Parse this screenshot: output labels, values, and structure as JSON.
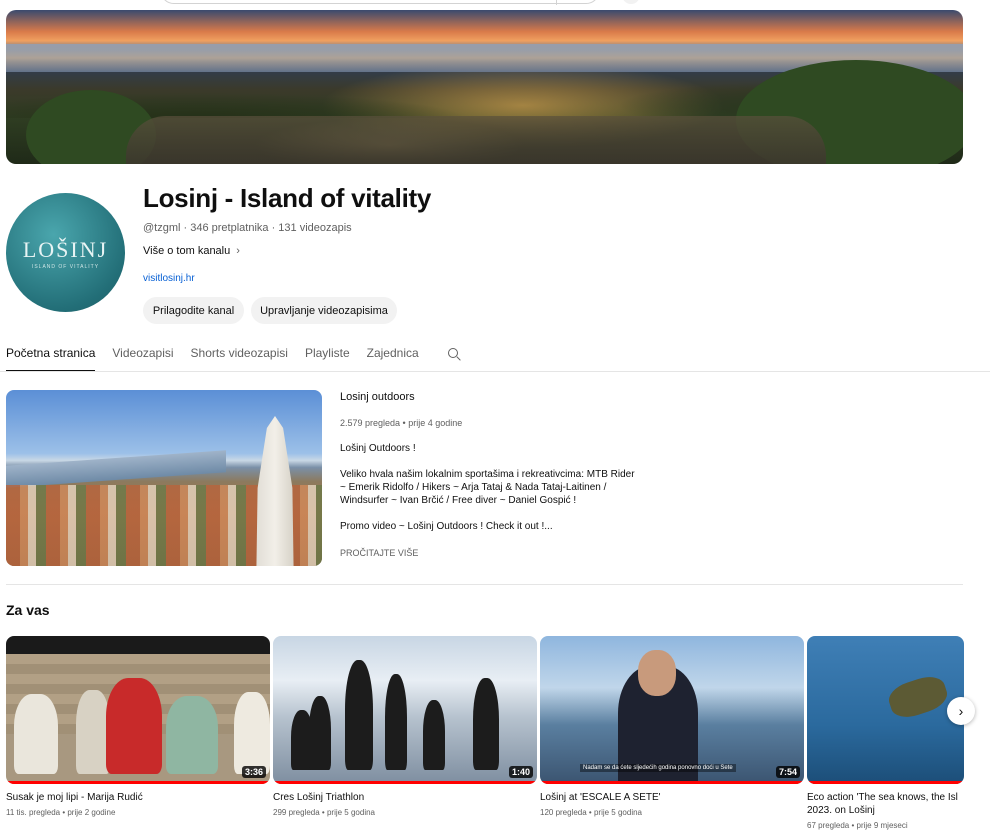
{
  "channel": {
    "name": "Losinj - Island of vitality",
    "handle": "@tzgml",
    "subscribers": "346 pretplatnika",
    "videos_count": "131 videozapis",
    "more_about": "Više o tom kanalu",
    "link": "visitlosinj.hr",
    "avatar_logo": "LOŠINJ",
    "avatar_logo_sub": "ISLAND OF VITALITY",
    "customize_label": "Prilagodite kanal",
    "manage_label": "Upravljanje videozapisima"
  },
  "tabs": [
    {
      "label": "Početna stranica",
      "active": true
    },
    {
      "label": "Videozapisi"
    },
    {
      "label": "Shorts videozapisi"
    },
    {
      "label": "Playliste"
    },
    {
      "label": "Zajednica"
    }
  ],
  "featured": {
    "title": "Losinj outdoors",
    "meta": "2.579 pregleda • prije 4 godine",
    "desc_line1": "Lošinj Outdoors !",
    "desc_line2": "Veliko hvala našim lokalnim sportašima i rekreativcima: MTB Rider ~ Emerik Ridolfo / Hikers ~ Arja Tataj & Nada Tataj-Laitinen / Windsurfer ~ Ivan Brčić / Free diver ~ Daniel Gospić !",
    "desc_line3": "Promo video ~ Lošinj Outdoors ! Check it out !...",
    "read_more": "PROČITAJTE VIŠE"
  },
  "for_you": {
    "title": "Za vas",
    "videos": [
      {
        "title": "Susak je moj lipi - Marija Rudić",
        "meta": "11 tis. pregleda • prije 2 godine",
        "duration": "3:36"
      },
      {
        "title": "Cres Lošinj Triathlon",
        "meta": "299 pregleda • prije 5 godina",
        "duration": "1:40"
      },
      {
        "title": "Lošinj at 'ESCALE A SETE'",
        "meta": "120 pregleda • prije 5 godina",
        "duration": "7:54",
        "caption": "Nadam se da ćete sljedećih godina ponovno doći u Sete"
      },
      {
        "title": "Eco action 'The sea knows, the Isl 2023. on Lošinj",
        "meta": "67 pregleda • prije 9 mjeseci"
      }
    ],
    "next_icon": "chevron-right-icon"
  },
  "colors": {
    "link": "#065fd4",
    "progress": "#ff0000",
    "chip_bg": "#f2f2f2"
  }
}
